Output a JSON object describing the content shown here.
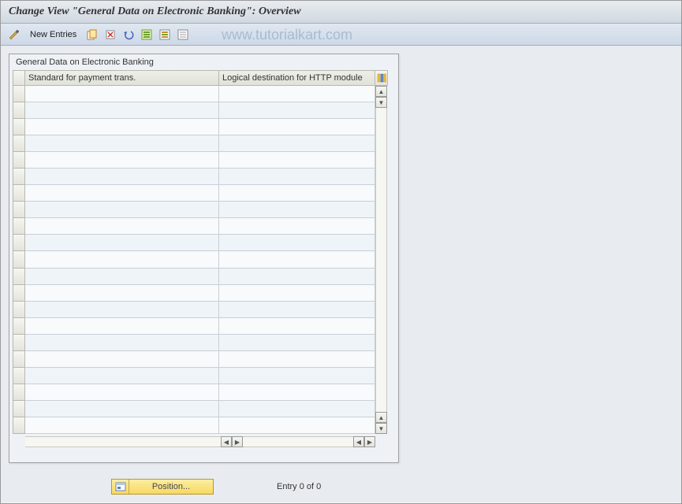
{
  "title": "Change View \"General Data on Electronic Banking\": Overview",
  "toolbar": {
    "new_entries_label": "New Entries"
  },
  "watermark": "www.tutorialkart.com",
  "panel": {
    "header": "General Data on Electronic Banking",
    "columns": {
      "col1": "Standard for payment trans.",
      "col2": "Logical destination for HTTP module"
    },
    "rows": [
      {
        "c1": "",
        "c2": ""
      },
      {
        "c1": "",
        "c2": ""
      },
      {
        "c1": "",
        "c2": ""
      },
      {
        "c1": "",
        "c2": ""
      },
      {
        "c1": "",
        "c2": ""
      },
      {
        "c1": "",
        "c2": ""
      },
      {
        "c1": "",
        "c2": ""
      },
      {
        "c1": "",
        "c2": ""
      },
      {
        "c1": "",
        "c2": ""
      },
      {
        "c1": "",
        "c2": ""
      },
      {
        "c1": "",
        "c2": ""
      },
      {
        "c1": "",
        "c2": ""
      },
      {
        "c1": "",
        "c2": ""
      },
      {
        "c1": "",
        "c2": ""
      },
      {
        "c1": "",
        "c2": ""
      },
      {
        "c1": "",
        "c2": ""
      },
      {
        "c1": "",
        "c2": ""
      },
      {
        "c1": "",
        "c2": ""
      },
      {
        "c1": "",
        "c2": ""
      },
      {
        "c1": "",
        "c2": ""
      },
      {
        "c1": "",
        "c2": ""
      }
    ]
  },
  "footer": {
    "position_label": "Position...",
    "entry_text": "Entry 0 of 0"
  }
}
